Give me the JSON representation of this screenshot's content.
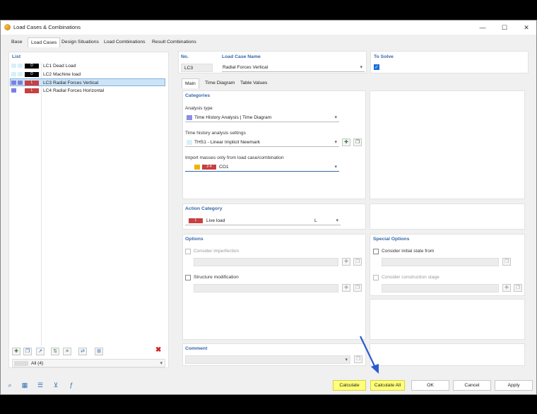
{
  "window": {
    "title": "Load Cases & Combinations",
    "min": "—",
    "max": "☐",
    "close": "✕"
  },
  "tabs": [
    "Base",
    "Load Cases",
    "Design Situations",
    "Load Combinations",
    "Result Combinations"
  ],
  "list": {
    "header": "List",
    "items": [
      {
        "tag": "D",
        "id": "LC1",
        "name": "Dead Load"
      },
      {
        "tag": "D",
        "id": "LC2",
        "name": "Machine load"
      },
      {
        "tag": "L",
        "id": "LC3",
        "name": "Radial Forces Vertical"
      },
      {
        "tag": "L",
        "id": "LC4",
        "name": "Radial Forces Horizontal"
      }
    ],
    "filter": "All (4)"
  },
  "top": {
    "no_label": "No.",
    "no_value": "LC3",
    "name_label": "Load Case Name",
    "name_value": "Radial Forces Vertical",
    "solve_label": "To Solve",
    "solve_check": "✓"
  },
  "subtabs": [
    "Main",
    "Time Diagram",
    "Table Values"
  ],
  "categories": {
    "header": "Categories",
    "analysis_label": "Analysis type",
    "analysis_value": "Time History Analysis | Time Diagram",
    "ths_label": "Time history analysis settings",
    "ths_value": "THS1 - Linear Implicit Newmark",
    "import_label": "Import masses only from load case/combination",
    "import_tag": "2-4",
    "import_value": "CO1"
  },
  "action": {
    "header": "Action Category",
    "tag": "L",
    "value": "Live load",
    "code": "L"
  },
  "options": {
    "header": "Options",
    "imperfection": "Consider imperfection",
    "structure": "Structure modification"
  },
  "special": {
    "header": "Special Options",
    "initial": "Consider initial state from",
    "construction": "Consider construction stage"
  },
  "comment": {
    "header": "Comment"
  },
  "buttons": {
    "calculate": "Calculate",
    "calculate_all": "Calculate All",
    "ok": "OK",
    "cancel": "Cancel",
    "apply": "Apply"
  },
  "icons": {
    "dropdown": "▾",
    "new": "✚",
    "copy": "❐",
    "delete": "✖"
  },
  "colors": {
    "accent": "#3567a8",
    "dead_tag": "#000000",
    "live_tag": "#c84040",
    "highlight": "#ffff7a",
    "arrow": "#2a5bd0"
  }
}
